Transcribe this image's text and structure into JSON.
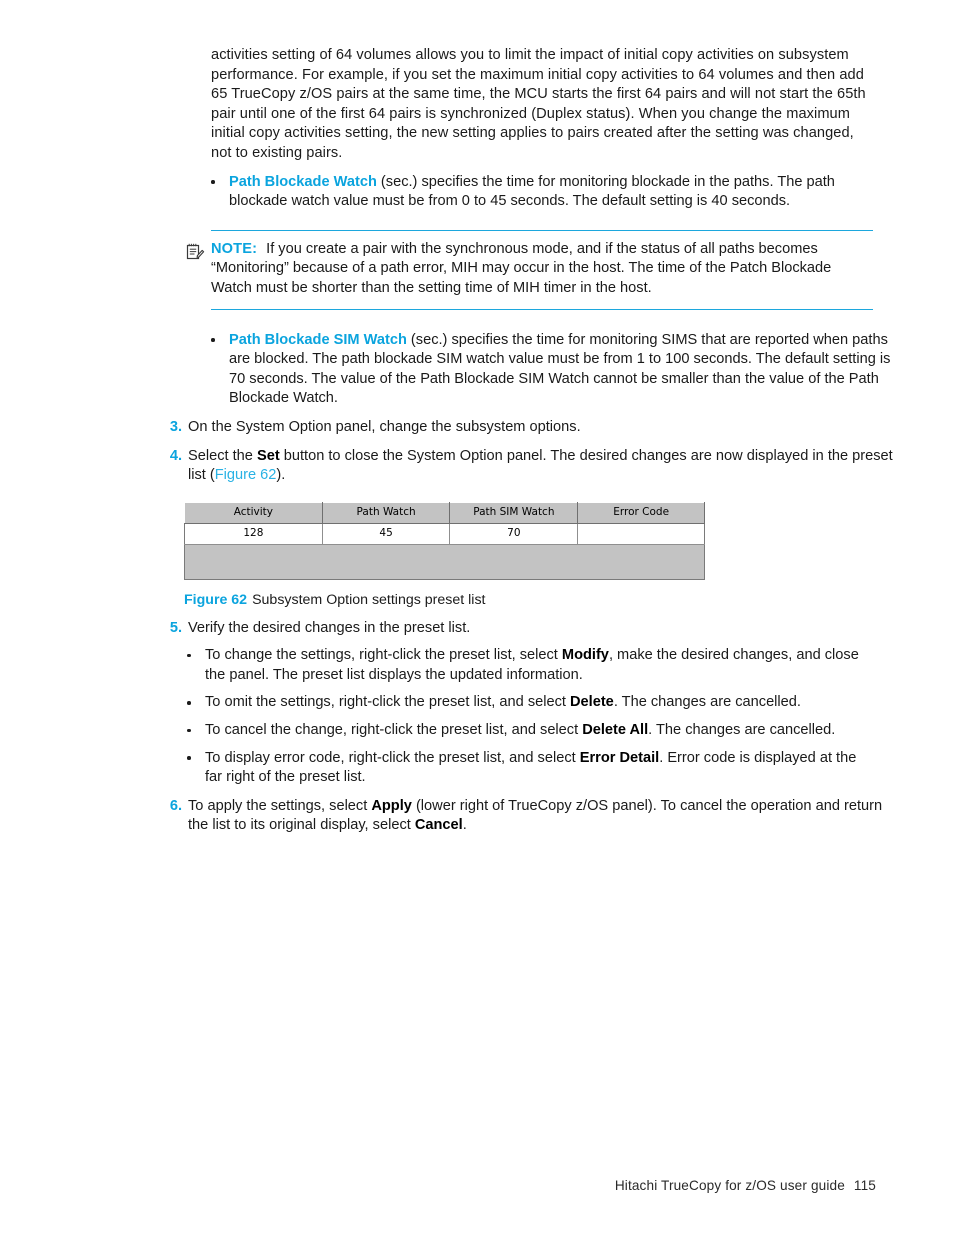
{
  "document": {
    "footer_title": "Hitachi TrueCopy for z/OS user guide",
    "page_number": "115"
  },
  "colors": {
    "accent": "#0ba4de",
    "link": "#29b2e4",
    "rule": "#1ca7dd",
    "body_text": "#1b1b1b",
    "table_gray": "#c3c3c3"
  },
  "body": {
    "intro_paragraph": "activities setting of 64 volumes allows you to limit the impact of initial copy activities on subsystem performance. For example, if you set the maximum initial copy activities to 64 volumes and then add 65 TrueCopy z/OS pairs at the same time, the MCU starts the first 64 pairs and will not start the 65th pair until one of the first 64 pairs is synchronized (Duplex status). When you change the maximum initial copy activities setting, the new setting applies to pairs created after the setting was changed, not to existing pairs.",
    "bullet_path_blockade_watch": {
      "term": "Path Blockade Watch",
      "rest": " (sec.) specifies the time for monitoring blockade in the paths. The path blockade watch value must be from 0 to 45 seconds. The default setting is 40 seconds."
    },
    "note": {
      "icon": "note-pad-icon",
      "label": "NOTE:",
      "text": "If you create a pair with the synchronous mode, and if the status of all paths becomes “Monitoring” because of a path error, MIH may occur in the host. The time of the Patch Blockade Watch must be shorter than the setting time of MIH timer in the host."
    },
    "bullet_path_blockade_sim_watch": {
      "term": "Path Blockade SIM Watch",
      "rest": " (sec.) specifies the time for monitoring SIMS that are reported when paths are blocked. The path blockade SIM watch value must be from 1 to 100 seconds. The default setting is 70 seconds. The value of the Path Blockade SIM Watch cannot be smaller than the value of the Path Blockade Watch."
    },
    "step3": {
      "num": "3.",
      "text": "On the System Option panel, change the subsystem options."
    },
    "step4": {
      "num": "4.",
      "part1": "Select the ",
      "bold1": "Set",
      "part2": " button to close the System Option panel. The desired changes are now displayed in the preset list (",
      "link": "Figure 62",
      "part3": ")."
    },
    "step5": {
      "num": "5.",
      "text": "Verify the desired changes in the preset list.",
      "bullets": [
        {
          "part1": "To change the settings, right-click the preset list, select ",
          "bold": "Modify",
          "part2": ", make the desired changes, and close the panel. The preset list displays the updated information."
        },
        {
          "part1": "To omit the settings, right-click the preset list, and select ",
          "bold": "Delete",
          "part2": ". The changes are cancelled."
        },
        {
          "part1": "To cancel the change, right-click the preset list, and select ",
          "bold": "Delete All",
          "part2": ". The changes are cancelled."
        },
        {
          "part1": "To display error code, right-click the preset list, and select ",
          "bold": "Error Detail",
          "part2": ". Error code is displayed at the far right of the preset list."
        }
      ]
    },
    "step6": {
      "num": "6.",
      "part1": "To apply the settings, select ",
      "bold1": "Apply",
      "part2": " (lower right of TrueCopy z/OS panel). To cancel the operation and return the list to its original display, select ",
      "bold2": "Cancel",
      "part3": "."
    }
  },
  "figure": {
    "number": "Figure 62",
    "title": "Subsystem Option settings preset list",
    "preset_list": {
      "columns": [
        "Activity",
        "Path Watch",
        "Path SIM Watch",
        "Error Code"
      ],
      "rows": [
        [
          "128",
          "45",
          "70",
          ""
        ]
      ]
    }
  }
}
